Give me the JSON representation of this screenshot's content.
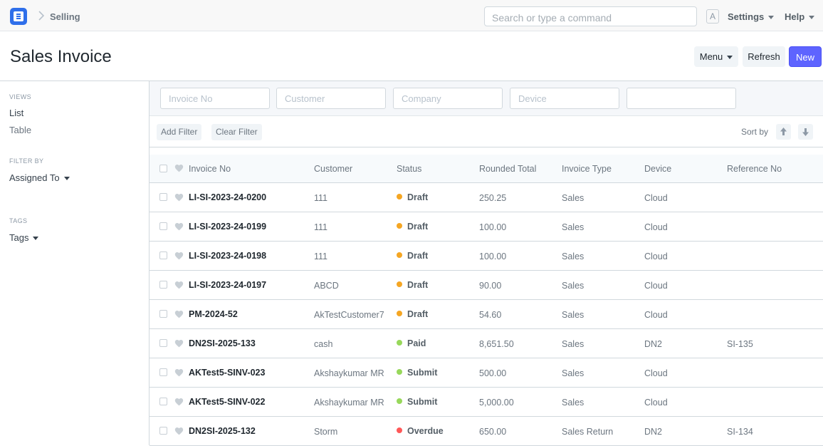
{
  "navbar": {
    "breadcrumb": "Selling",
    "search_placeholder": "Search or type a command",
    "avatar_letter": "A",
    "settings_label": "Settings",
    "help_label": "Help"
  },
  "page": {
    "title": "Sales Invoice",
    "menu_label": "Menu",
    "refresh_label": "Refresh",
    "new_label": "New"
  },
  "sidebar": {
    "views_heading": "VIEWS",
    "views": [
      "List",
      "Table"
    ],
    "filter_heading": "FILTER BY",
    "assigned_to": "Assigned To",
    "tags_heading": "TAGS",
    "tags": "Tags"
  },
  "filters": {
    "inputs": [
      "Invoice No",
      "Customer",
      "Company",
      "Device",
      ""
    ],
    "add_filter": "Add Filter",
    "clear_filter": "Clear Filter",
    "sort_by": "Sort by"
  },
  "table": {
    "columns": [
      "Invoice No",
      "Customer",
      "Status",
      "Rounded Total",
      "Invoice Type",
      "Device",
      "Reference No"
    ],
    "rows": [
      {
        "invoice": "LI-SI-2023-24-0200",
        "customer": "111",
        "status": "Draft",
        "total": "250.25",
        "type": "Sales",
        "device": "Cloud",
        "ref": ""
      },
      {
        "invoice": "LI-SI-2023-24-0199",
        "customer": "111",
        "status": "Draft",
        "total": "100.00",
        "type": "Sales",
        "device": "Cloud",
        "ref": ""
      },
      {
        "invoice": "LI-SI-2023-24-0198",
        "customer": "111",
        "status": "Draft",
        "total": "100.00",
        "type": "Sales",
        "device": "Cloud",
        "ref": ""
      },
      {
        "invoice": "LI-SI-2023-24-0197",
        "customer": "ABCD",
        "status": "Draft",
        "total": "90.00",
        "type": "Sales",
        "device": "Cloud",
        "ref": ""
      },
      {
        "invoice": "PM-2024-52",
        "customer": "AkTestCustomer7",
        "status": "Draft",
        "total": "54.60",
        "type": "Sales",
        "device": "Cloud",
        "ref": ""
      },
      {
        "invoice": "DN2SI-2025-133",
        "customer": "cash",
        "status": "Paid",
        "total": "8,651.50",
        "type": "Sales",
        "device": "DN2",
        "ref": "SI-135"
      },
      {
        "invoice": "AKTest5-SINV-023",
        "customer": "Akshaykumar MR",
        "status": "Submit",
        "total": "500.00",
        "type": "Sales",
        "device": "Cloud",
        "ref": ""
      },
      {
        "invoice": "AKTest5-SINV-022",
        "customer": "Akshaykumar MR",
        "status": "Submit",
        "total": "5,000.00",
        "type": "Sales",
        "device": "Cloud",
        "ref": ""
      },
      {
        "invoice": "DN2SI-2025-132",
        "customer": "Storm",
        "status": "Overdue",
        "total": "650.00",
        "type": "Sales Return",
        "device": "DN2",
        "ref": "SI-134"
      }
    ]
  },
  "colors": {
    "Draft": "#f5a623",
    "Paid": "#98d85b",
    "Submit": "#98d85b",
    "Overdue": "#ff5858",
    "accent": "#5e64ff",
    "logo": "#2f6fea"
  }
}
